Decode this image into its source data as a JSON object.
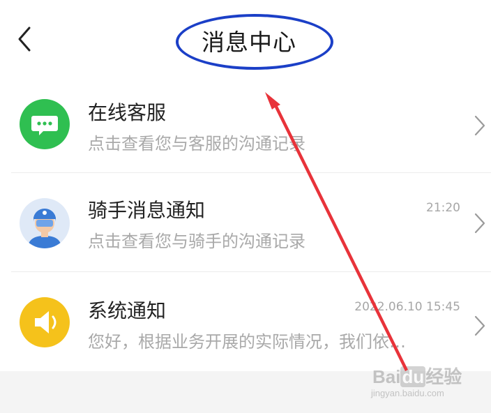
{
  "header": {
    "title": "消息中心",
    "back_icon": "chevron-left-icon"
  },
  "items": [
    {
      "name": "在线客服",
      "desc": "点击查看您与客服的沟通记录",
      "time": "",
      "icon": "chat-bubble-icon",
      "color": "#2fbf51"
    },
    {
      "name": "骑手消息通知",
      "desc": "点击查看您与骑手的沟通记录",
      "time": "21:20",
      "icon": "rider-avatar-icon",
      "color": "#3a7bd5"
    },
    {
      "name": "系统通知",
      "desc": "您好，根据业务开展的实际情况，我们依…",
      "time": "2022.06.10  15:45",
      "icon": "speaker-icon",
      "color": "#f5c21b"
    }
  ],
  "annotation": {
    "ellipse_color": "#1b3fc7",
    "arrow_color": "#e8333a"
  },
  "watermark": {
    "main": "Baidu经验",
    "sub": "jingyan.baidu.com"
  }
}
